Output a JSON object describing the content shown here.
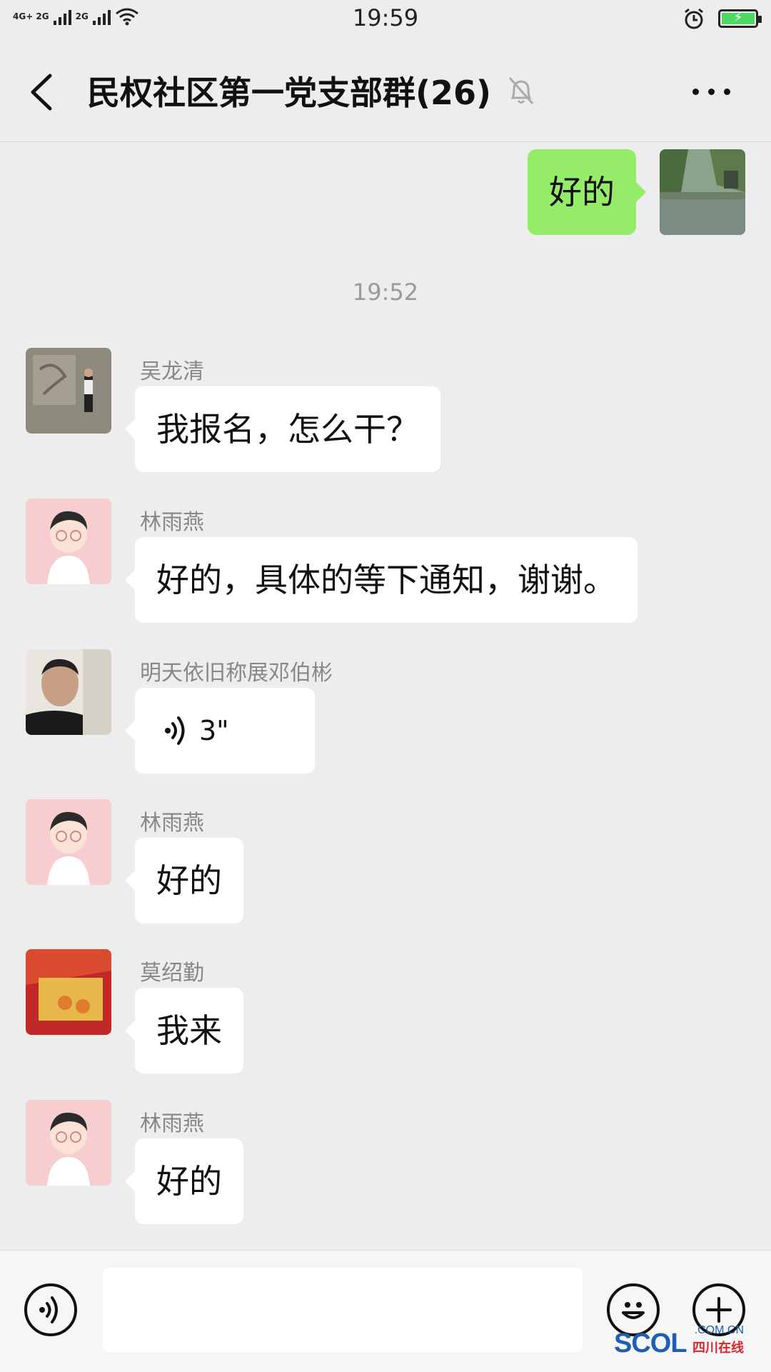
{
  "status_bar": {
    "network_label": "4G+ 2G",
    "network2_label": "2G",
    "time": "19:59"
  },
  "header": {
    "title": "民权社区第一党支部群(26)"
  },
  "messages": {
    "sent_1": "好的",
    "timestamp_1": "19:52",
    "m1_sender": "吴龙清",
    "m1_text": "我报名，怎么干？",
    "m2_sender": "林雨燕",
    "m2_text": "好的，具体的等下通知，谢谢。",
    "m3_sender": "明天依旧称展邓伯彬",
    "m3_voice_duration": "3\"",
    "m4_sender": "林雨燕",
    "m4_text": "好的",
    "m5_sender": "莫绍勤",
    "m5_text": "我来",
    "m6_sender": "林雨燕",
    "m6_text": "好的"
  },
  "input": {
    "value": ""
  },
  "watermark": {
    "brand": "SCOL",
    "domain": ".COM.CN",
    "cn_name": "四川在线"
  },
  "colors": {
    "sent_bubble": "#95ec69",
    "received_bubble": "#ffffff",
    "background": "#ededed"
  }
}
